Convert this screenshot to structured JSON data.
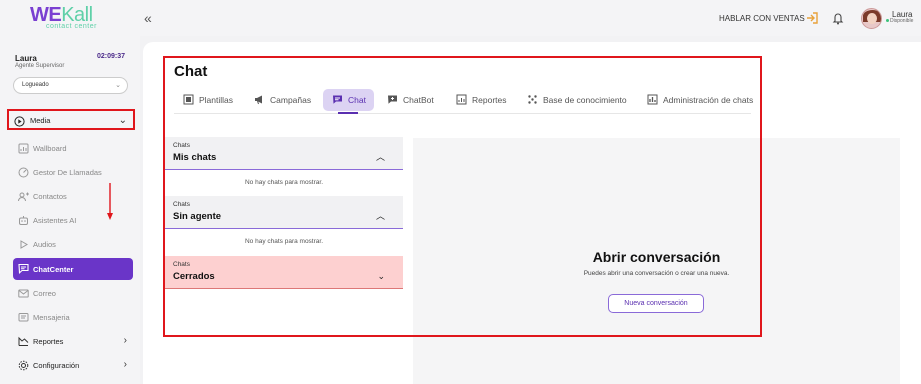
{
  "brand": {
    "logo_we": "WE",
    "logo_kall": "Kall",
    "tagline": "contact center"
  },
  "topbar": {
    "collapse_glyph": "«",
    "hablar_label": "HABLAR CON VENTAS",
    "user_name": "Laura",
    "user_status": "Disponible"
  },
  "agent": {
    "name": "Laura",
    "role": "Agente Supervisor",
    "time": "02:09:37",
    "status_value": "Logueado"
  },
  "sidebar": {
    "items": [
      {
        "label": "Media",
        "icon": "play-circle-icon"
      },
      {
        "label": "Wallboard",
        "icon": "wallboard-icon"
      },
      {
        "label": "Gestor De Llamadas",
        "icon": "phone-gauge-icon"
      },
      {
        "label": "Contactos",
        "icon": "add-contact-icon"
      },
      {
        "label": "Asistentes AI",
        "icon": "robot-icon"
      },
      {
        "label": "Audios",
        "icon": "play-icon"
      },
      {
        "label": "ChatCenter",
        "icon": "chat-icon"
      },
      {
        "label": "Correo",
        "icon": "mail-icon"
      },
      {
        "label": "Mensajeria",
        "icon": "message-icon"
      },
      {
        "label": "Reportes",
        "icon": "reports-icon"
      },
      {
        "label": "Configuración",
        "icon": "gear-icon"
      }
    ]
  },
  "main": {
    "title": "Chat",
    "tabs": [
      {
        "label": "Plantillas"
      },
      {
        "label": "Campañas"
      },
      {
        "label": "Chat"
      },
      {
        "label": "ChatBot"
      },
      {
        "label": "Reportes"
      },
      {
        "label": "Base de conocimiento"
      },
      {
        "label": "Administración de chats"
      }
    ],
    "active_tab": "Chat",
    "sections": [
      {
        "caption": "Chats",
        "title": "Mis chats",
        "empty": "No hay chats para mostrar.",
        "expanded": true
      },
      {
        "caption": "Chats",
        "title": "Sin agente",
        "empty": "No hay chats para mostrar.",
        "expanded": true
      },
      {
        "caption": "Chats",
        "title": "Cerrados",
        "expanded": false
      }
    ],
    "open_conversation": {
      "title": "Abrir conversación",
      "subtitle": "Puedes abrir una conversación o crear una nueva.",
      "button": "Nueva conversación"
    }
  },
  "colors": {
    "accent": "#6a35c8",
    "highlight_red": "#e0161c",
    "closed_bg": "#fdd0d0"
  }
}
